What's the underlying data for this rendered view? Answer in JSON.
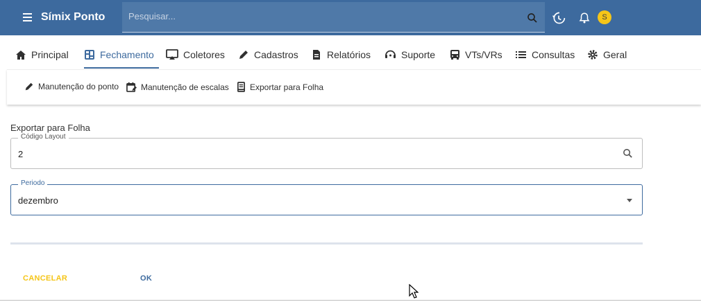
{
  "app": {
    "title": "Símix Ponto",
    "avatar_letter": "S"
  },
  "search": {
    "placeholder": "Pesquisar..."
  },
  "tabs": [
    {
      "label": "Principal",
      "icon": "home-icon"
    },
    {
      "label": "Fechamento",
      "icon": "dashboard-icon"
    },
    {
      "label": "Coletores",
      "icon": "monitor-icon"
    },
    {
      "label": "Cadastros",
      "icon": "pencil-icon"
    },
    {
      "label": "Relatórios",
      "icon": "document-icon"
    },
    {
      "label": "Suporte",
      "icon": "support-icon"
    },
    {
      "label": "VTs/VRs",
      "icon": "bus-icon"
    },
    {
      "label": "Consultas",
      "icon": "list-icon"
    },
    {
      "label": "Geral",
      "icon": "gear-icon"
    }
  ],
  "active_tab": "Fechamento",
  "submenu": [
    {
      "label": "Manutenção do ponto",
      "icon": "pencil-icon"
    },
    {
      "label": "Manutenção de escalas",
      "icon": "calendar-edit-icon"
    },
    {
      "label": "Exportar para Folha",
      "icon": "book-icon"
    }
  ],
  "form": {
    "title": "Exportar para Folha",
    "layout_code": {
      "label": "Código Layout",
      "value": "2"
    },
    "period": {
      "label": "Periodo",
      "value": "dezembro"
    }
  },
  "actions": {
    "cancel": "CANCELAR",
    "ok": "OK"
  },
  "colors": {
    "primary": "#3d6a9e",
    "accent": "#f5c518"
  }
}
